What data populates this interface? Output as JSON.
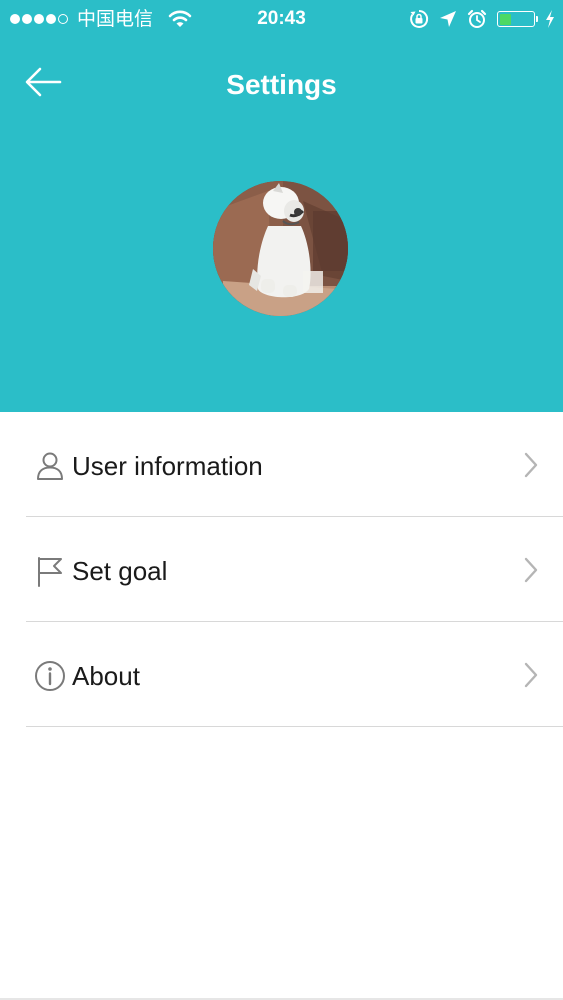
{
  "status_bar": {
    "carrier": "中国电信",
    "time": "20:43",
    "signal_bars_filled": 4,
    "signal_bars_total": 5,
    "battery_level": 0.35,
    "battery_color": "#4cd964",
    "icons": [
      "wifi-icon",
      "rotation-lock-icon",
      "location-icon",
      "alarm-icon",
      "battery-icon",
      "charging-icon"
    ]
  },
  "header": {
    "title": "Settings",
    "background_color": "#2bbec8",
    "back_icon": "arrow-left-icon"
  },
  "profile": {
    "avatar": "user-avatar-photo"
  },
  "menu": {
    "items": [
      {
        "label": "User information",
        "icon": "person-icon"
      },
      {
        "label": "Set goal",
        "icon": "flag-icon"
      },
      {
        "label": "About",
        "icon": "info-icon"
      }
    ],
    "chevron_icon": "chevron-right-icon"
  }
}
